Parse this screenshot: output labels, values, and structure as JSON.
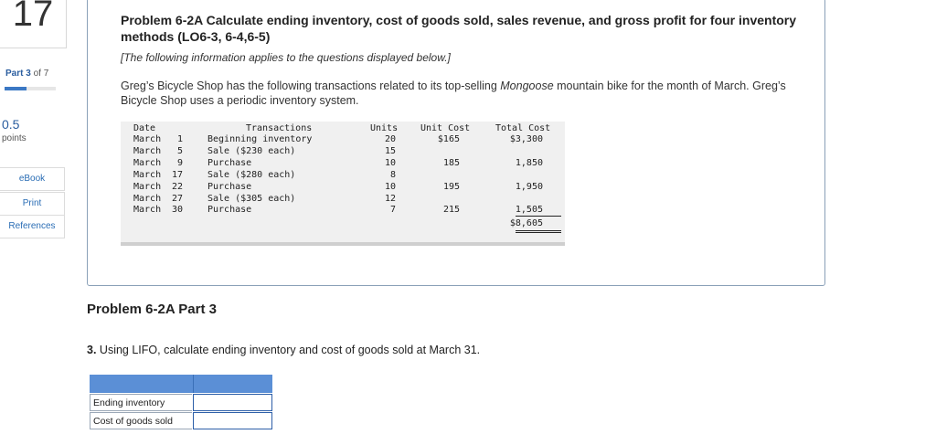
{
  "sidebar": {
    "question_number": "17",
    "part_label_prefix": "Part ",
    "part_current": "3",
    "part_suffix": " of 7",
    "progress_fraction": 0.43,
    "points_value": "0.5",
    "points_label": "points",
    "buttons": {
      "ebook": "eBook",
      "print": "Print",
      "references": "References"
    }
  },
  "problem": {
    "title": "Problem 6-2A Calculate ending inventory, cost of goods sold, sales revenue, and gross profit for four inventory methods (LO6-3, 6-4,6-5)",
    "note": "[The following information applies to the questions displayed below.]",
    "desc_before": "Greg’s Bicycle Shop has the following transactions related to its top-selling ",
    "desc_italic": "Mongoose",
    "desc_after": " mountain bike for the month of March. Greg’s Bicycle Shop uses a periodic inventory system."
  },
  "transactions_table": {
    "headers": {
      "date": "Date",
      "transactions": "Transactions",
      "units": "Units",
      "unit_cost": "Unit Cost",
      "total_cost": "Total Cost"
    },
    "rows": [
      {
        "month": "March",
        "day": "1",
        "desc": "Beginning inventory",
        "units": "20",
        "unit_cost": "$165",
        "total_cost": "$3,300"
      },
      {
        "month": "March",
        "day": "5",
        "desc": "Sale ($230 each)",
        "units": "15",
        "unit_cost": "",
        "total_cost": ""
      },
      {
        "month": "March",
        "day": "9",
        "desc": "Purchase",
        "units": "10",
        "unit_cost": "185",
        "total_cost": "1,850"
      },
      {
        "month": "March",
        "day": "17",
        "desc": "Sale ($280 each)",
        "units": "8",
        "unit_cost": "",
        "total_cost": ""
      },
      {
        "month": "March",
        "day": "22",
        "desc": "Purchase",
        "units": "10",
        "unit_cost": "195",
        "total_cost": "1,950"
      },
      {
        "month": "March",
        "day": "27",
        "desc": "Sale ($305 each)",
        "units": "12",
        "unit_cost": "",
        "total_cost": ""
      },
      {
        "month": "March",
        "day": "30",
        "desc": "Purchase",
        "units": "7",
        "unit_cost": "215",
        "total_cost": "1,505"
      }
    ],
    "grand_total": "$8,605"
  },
  "part3": {
    "title": "Problem 6-2A Part 3",
    "question_number": "3.",
    "question_text": " Using LIFO, calculate ending inventory and cost of goods sold at March 31.",
    "answer_rows": [
      {
        "label": "Ending inventory",
        "value": ""
      },
      {
        "label": "Cost of goods sold",
        "value": ""
      }
    ]
  }
}
